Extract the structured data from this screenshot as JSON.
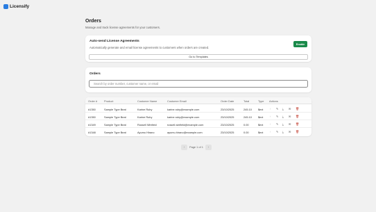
{
  "app": {
    "name": "Licensify"
  },
  "page": {
    "title": "Orders",
    "subtitle": "Manage and track license agreements for your customers."
  },
  "auto_send": {
    "title": "Auto-send License Agreements",
    "description": "Automatically generate and email license agreements to customers when orders are created.",
    "enable_label": "Enable",
    "templates_label": "Go to Templates"
  },
  "orders": {
    "title": "Orders",
    "search_placeholder": "Search by order number, customer name, or email"
  },
  "table": {
    "headers": [
      "Order #",
      "Product",
      "Customer Name",
      "Customer Email",
      "Order Date",
      "Total",
      "Type",
      "Actions"
    ],
    "rows": [
      {
        "order": "#1350",
        "product": "Sample Type Beat",
        "name": "Karine Ruby",
        "email": "karine.ruby@example.com",
        "date": "23/10/2025",
        "total": "245.10",
        "type": "$ext"
      },
      {
        "order": "#1350",
        "product": "Sample Type Beat",
        "name": "Karine Ruby",
        "email": "karine.ruby@example.com",
        "date": "23/10/2025",
        "total": "245.10",
        "type": "$ext"
      },
      {
        "order": "#1349",
        "product": "Sample Type Beat",
        "name": "Russell Winfield",
        "email": "russell.winfield@example.com",
        "date": "23/10/2025",
        "total": "0.00",
        "type": "$ext"
      },
      {
        "order": "#1348",
        "product": "Sample Type Beat",
        "name": "Ayumu Hirano",
        "email": "ayumu.hirano@example.com",
        "date": "23/10/2025",
        "total": "0.00",
        "type": "$ext"
      }
    ]
  },
  "pagination": {
    "label": "Page 1 of 1",
    "prev": "‹",
    "next": "›"
  },
  "icons": {
    "view": "eye-icon",
    "edit": "pencil-icon",
    "download": "download-icon",
    "email": "mail-icon",
    "delete": "trash-icon"
  },
  "colors": {
    "enable": "#1a8a4a",
    "delete": "#c0392b",
    "logo": "#2a7de1"
  }
}
